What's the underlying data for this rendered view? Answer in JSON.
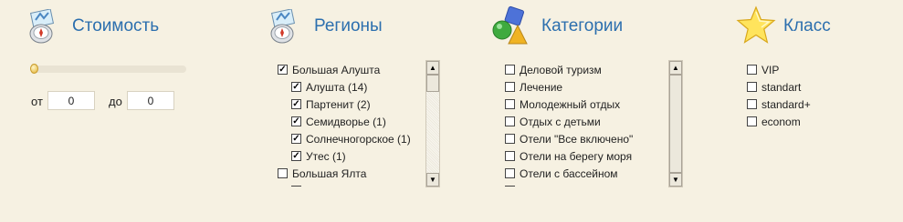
{
  "cost": {
    "title": "Стоимость",
    "icon": "compass-map-icon",
    "from_label": "от",
    "to_label": "до",
    "from_value": "0",
    "to_value": "0",
    "slider_level": 0
  },
  "regions": {
    "title": "Регионы",
    "icon": "compass-map-icon",
    "items": [
      {
        "label": "Большая Алушта",
        "checked": true
      },
      {
        "label": "Алушта (14)",
        "checked": true
      },
      {
        "label": "Партенит (2)",
        "checked": true
      },
      {
        "label": "Семидворье (1)",
        "checked": true
      },
      {
        "label": "Солнечногорское (1)",
        "checked": true
      },
      {
        "label": "Утес (1)",
        "checked": true
      },
      {
        "label": "Большая Ялта",
        "checked": false
      }
    ]
  },
  "categories": {
    "title": "Категории",
    "icon": "shapes-icon",
    "items": [
      {
        "label": "Деловой туризм",
        "checked": false
      },
      {
        "label": "Лечение",
        "checked": false
      },
      {
        "label": "Молодежный отдых",
        "checked": false
      },
      {
        "label": "Отдых с детьми",
        "checked": false
      },
      {
        "label": "Отели \"Все включено\"",
        "checked": false
      },
      {
        "label": "Отели на берегу моря",
        "checked": false
      },
      {
        "label": "Отели с бассейном",
        "checked": false
      }
    ]
  },
  "class": {
    "title": "Класс",
    "icon": "star-icon",
    "items": [
      {
        "label": "VIP",
        "checked": false
      },
      {
        "label": "standart",
        "checked": false
      },
      {
        "label": "standard+",
        "checked": false
      },
      {
        "label": "econom",
        "checked": false
      }
    ]
  },
  "colors": {
    "title": "#2c6fae",
    "background": "#f6f1e2"
  }
}
